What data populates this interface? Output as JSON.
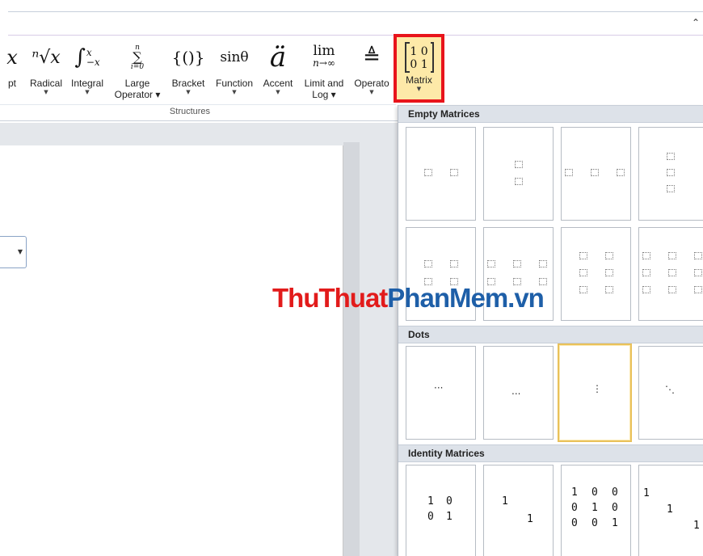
{
  "ribbon": {
    "collapse_icon": "chevron-up-icon",
    "group_label": "Structures",
    "buttons": [
      {
        "id": "script",
        "label": "pt",
        "label2": "",
        "glyph": "x"
      },
      {
        "id": "radical",
        "label": "Radical",
        "label2": "",
        "glyph": "ⁿ√x"
      },
      {
        "id": "integral",
        "label": "Integral",
        "label2": "",
        "glyph": "∫"
      },
      {
        "id": "large-operator",
        "label": "Large",
        "label2": "Operator ▾",
        "glyph": "∑"
      },
      {
        "id": "bracket",
        "label": "Bracket",
        "label2": "",
        "glyph": "{()}"
      },
      {
        "id": "function",
        "label": "Function",
        "label2": "",
        "glyph": "sinθ"
      },
      {
        "id": "accent",
        "label": "Accent",
        "label2": "",
        "glyph": "ä"
      },
      {
        "id": "limit-log",
        "label": "Limit and",
        "label2": "Log ▾",
        "glyph": "lim"
      },
      {
        "id": "operator",
        "label": "Operato",
        "label2": "",
        "glyph": "≜"
      }
    ],
    "matrix": {
      "label": "Matrix",
      "glyph_row1": "1 0",
      "glyph_row2": "0 1"
    }
  },
  "gallery": {
    "sections": [
      {
        "title": "Empty Matrices"
      },
      {
        "title": "Dots"
      },
      {
        "title": "Identity Matrices"
      }
    ],
    "dots": [
      "···",
      "...",
      "⋮",
      "⋱"
    ],
    "identity": {
      "m2": [
        [
          "1",
          "0"
        ],
        [
          "0",
          "1"
        ]
      ],
      "m2s": [
        "1",
        "1"
      ],
      "m3": [
        [
          "1",
          "0",
          "0"
        ],
        [
          "0",
          "1",
          "0"
        ],
        [
          "0",
          "0",
          "1"
        ]
      ],
      "m3s": [
        "1",
        "1",
        "1"
      ]
    }
  },
  "watermark": {
    "part1": "ThuThuat",
    "part2": "PhanMem.vn"
  }
}
